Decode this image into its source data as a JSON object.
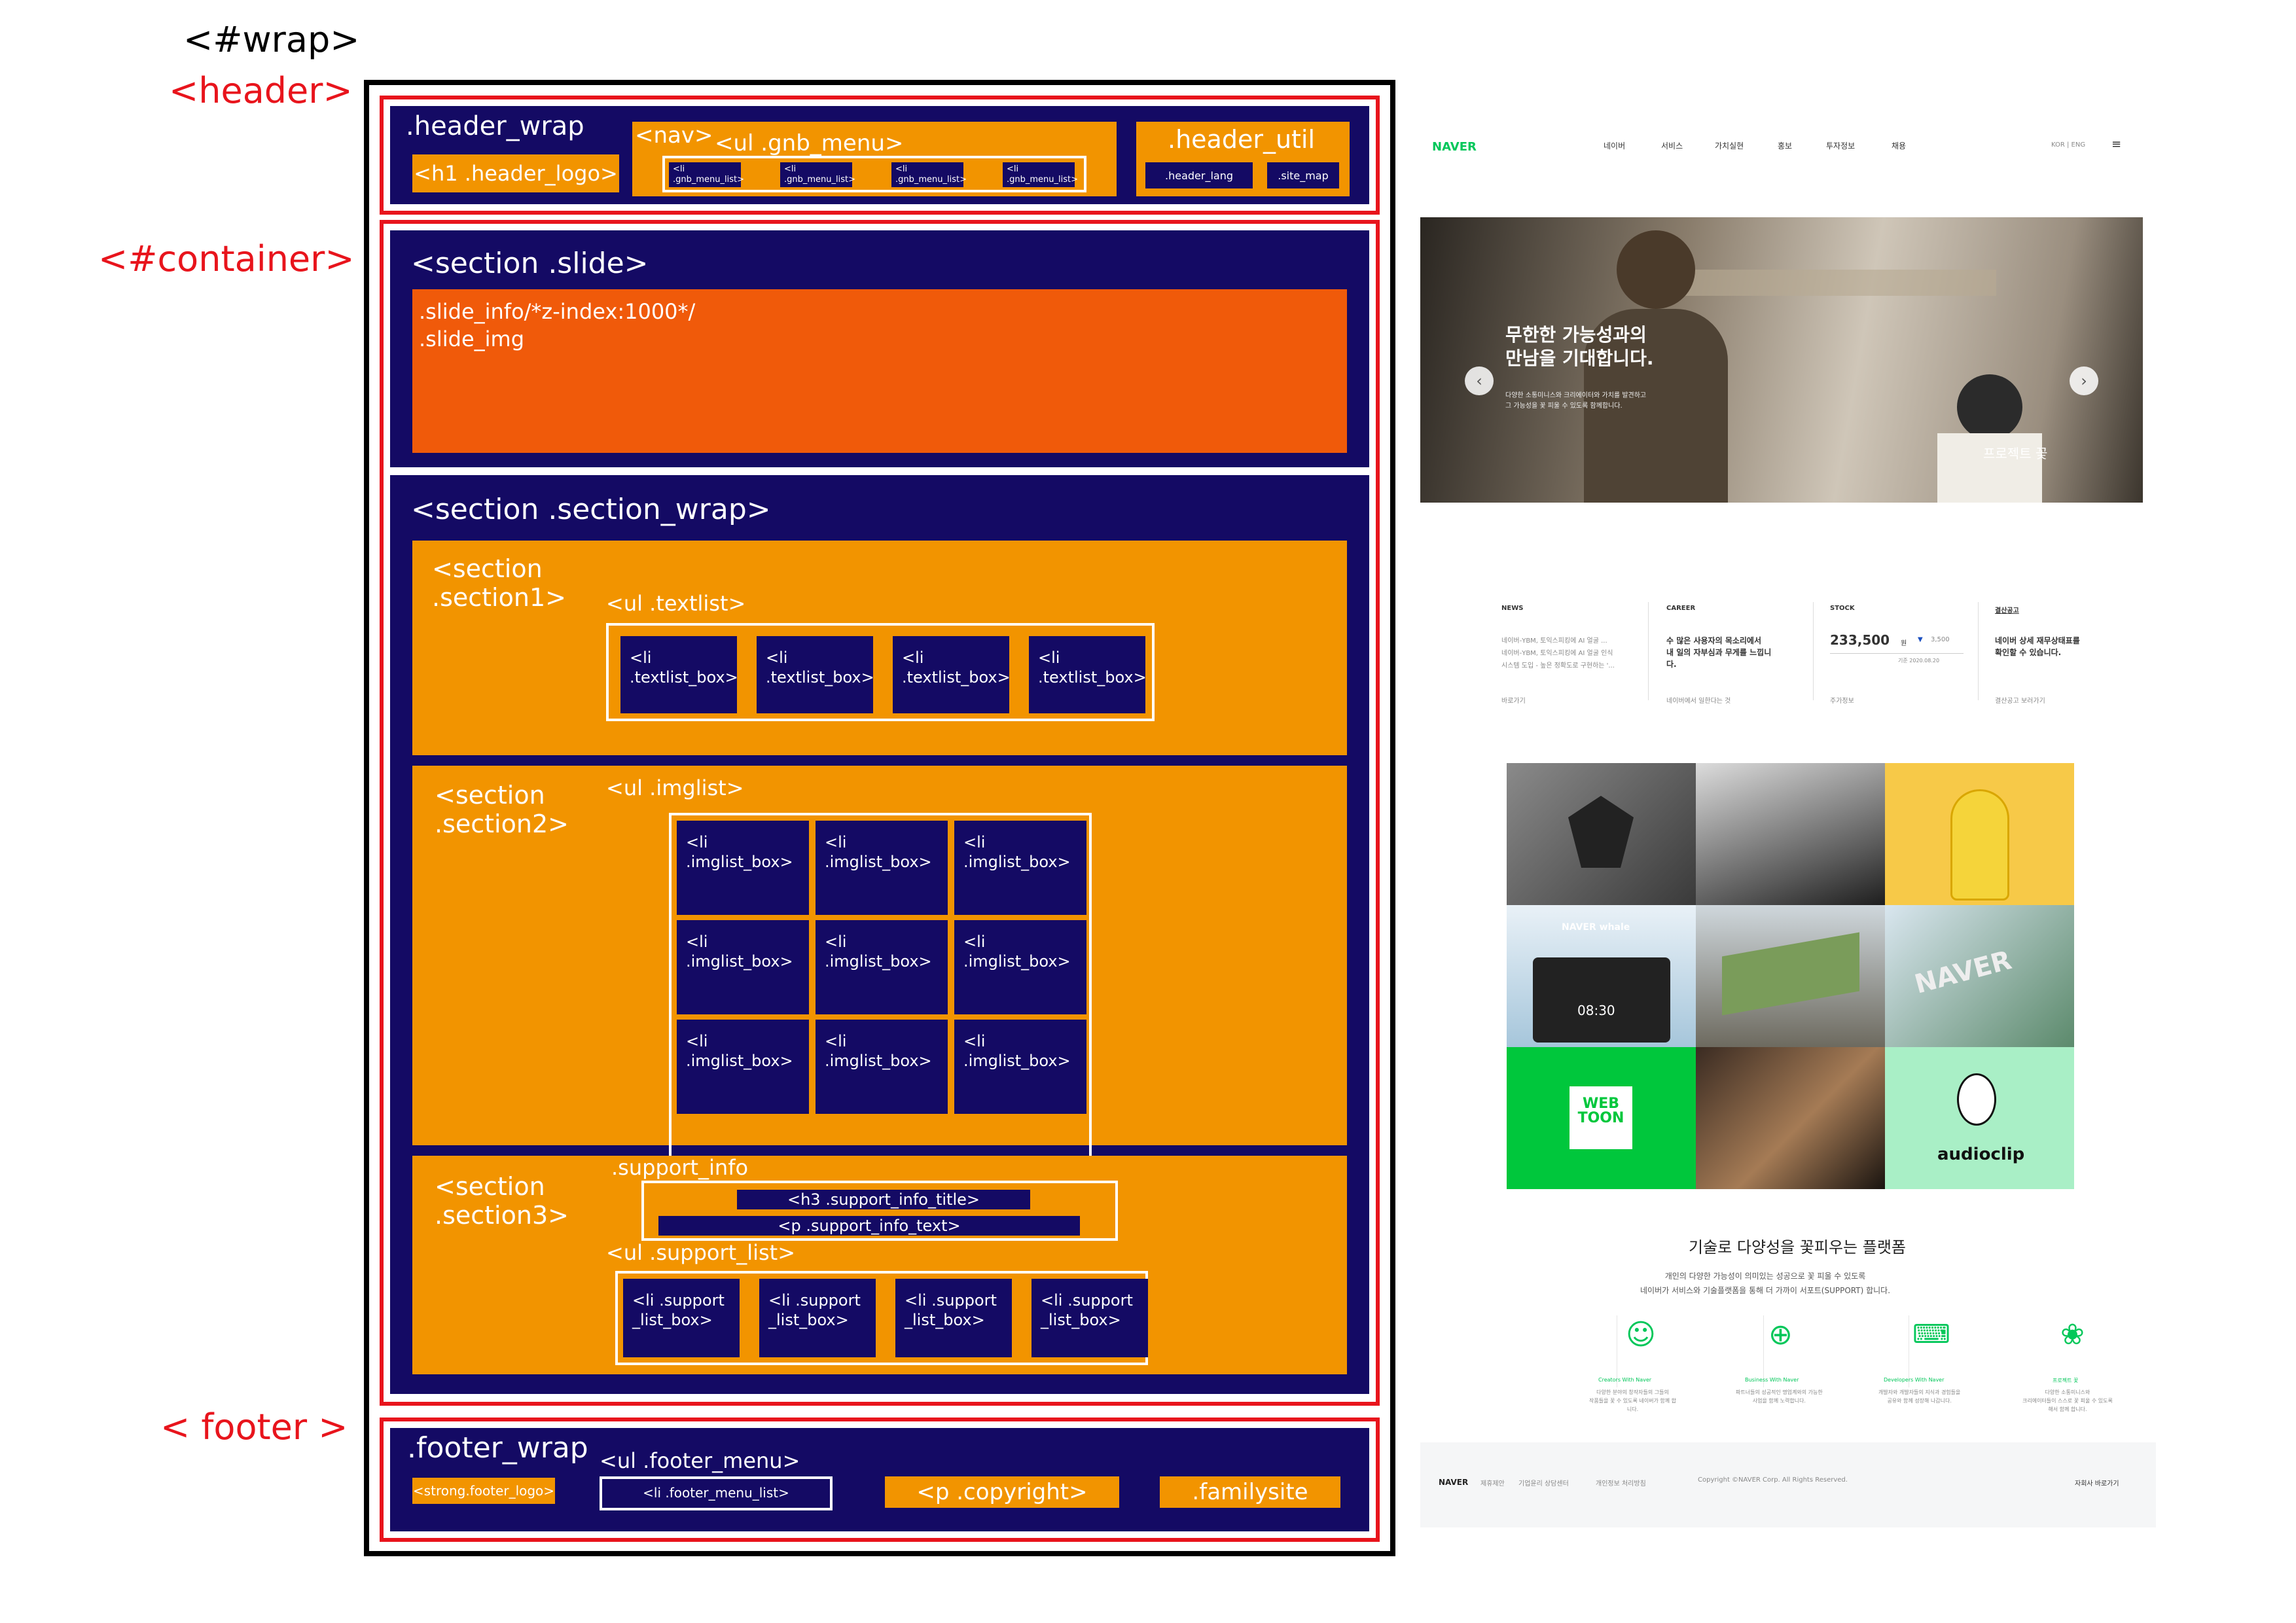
{
  "side_labels": {
    "wrap": "<#wrap>",
    "header": "<header>",
    "container": "<#container>",
    "footer": "< footer >"
  },
  "header": {
    "wrap": ".header_wrap",
    "logo": "<h1 .header_logo>",
    "nav": "<nav>",
    "gnb": "<ul .gnb_menu>",
    "gnb_items": [
      "<li\n.gnb_menu_list>",
      "<li\n.gnb_menu_list>",
      "<li\n.gnb_menu_list>",
      "<li\n.gnb_menu_list>"
    ],
    "util": ".header_util",
    "lang": ".header_lang",
    "sitemap": ".site_map"
  },
  "slide": {
    "title": "<section .slide>",
    "info": ".slide_info/*z-index:1000*/\n.slide_img"
  },
  "section_wrap": {
    "title": "<section .section_wrap>",
    "section1": {
      "label": "<section\n.section1>",
      "list": "<ul .textlist>",
      "items": [
        "<li\n.textlist_box>",
        "<li\n.textlist_box>",
        "<li\n.textlist_box>",
        "<li\n.textlist_box>"
      ]
    },
    "section2": {
      "label": "<section\n.section2>",
      "list": "<ul .imglist>",
      "items": [
        "<li\n.imglist_box>",
        "<li\n.imglist_box>",
        "<li\n.imglist_box>",
        "<li\n.imglist_box>",
        "<li\n.imglist_box>",
        "<li\n.imglist_box>",
        "<li\n.imglist_box>",
        "<li\n.imglist_box>",
        "<li\n.imglist_box>"
      ]
    },
    "section3": {
      "label": "<section\n.section3>",
      "info": ".support_info",
      "title": "<h3 .support_info_title>",
      "text": "<p .support_info_text>",
      "list": "<ul .support_list>",
      "items": [
        "<li .support\n_list_box>",
        "<li .support\n_list_box>",
        "<li .support\n_list_box>",
        "<li .support\n_list_box>"
      ]
    }
  },
  "footer": {
    "wrap": ".footer_wrap",
    "logo": "<strong.footer_logo>",
    "menu": "<ul .footer_menu>",
    "menu_item": "<li .footer_menu_list>",
    "copyright": "<p .copyright>",
    "familysite": ".familysite"
  },
  "mockup": {
    "logo": "NAVER",
    "nav": [
      "네이버",
      "서비스",
      "가치실현",
      "홍보",
      "투자정보",
      "채용"
    ],
    "lang": "KOR  |  ENG",
    "hero_title": "무한한 가능성과의\n만남을 기대합니다.",
    "hero_text": "다양한 소통미니스와 크리에이터와 가치를 발견하고\n그 가능성을 꽃 피울 수 있도록 함께합니다.",
    "hero_caption": "프로젝트 꽃",
    "news": {
      "label": "NEWS",
      "text": "네이버-YBM, 토익스피킹에 AI 얼굴 ...\n네이버-YBM, 토익스피킹에 AI 얼굴 인식\n시스템 도입 - 높은 정확도로 구현하는 '...",
      "link": "바로가기"
    },
    "career": {
      "label": "CAREER",
      "text": "수 많은 사용자의 목소리에서\n내 일의 자부심과 무게를 느낍니\n다.",
      "link": "네이버에서 일한다는 것"
    },
    "stock": {
      "label": "STOCK",
      "value": "233,500",
      "unit": "원",
      "delta": "3,500",
      "date": "기준 2020.08.20",
      "link": "주가정보"
    },
    "notice": {
      "label": "결산공고",
      "text": "네이버 상세 재무상태표를\n확인할 수 있습니다.",
      "link": "결산공고 보러가기"
    },
    "tiles": {
      "whale": "NAVER whale",
      "time": "08:30",
      "naver": "NAVER",
      "webtoon": "WEB\nTOON",
      "audioclip": "audioclip"
    },
    "support_title": "기술로 다양성을 꽃피우는 플랫폼",
    "support_text": "개인의 다양한 가능성이 의미있는 성공으로 꽃 피울 수 있도록\n네이버가 서비스와 기술플랫폼을 통해 더 가까이 서포트(SUPPORT) 합니다.",
    "support_items": [
      {
        "label": "Creators With Naver",
        "desc": "다양한 분야의 창작자들의 그들의\n작품들을 꽃 수 있도록 네이버가 함께 합\n니다."
      },
      {
        "label": "Business With Naver",
        "desc": "파트너들의 성공적인 명업계와의 가능한\n사업을 함께 노력합니다."
      },
      {
        "label": "Developers With Naver",
        "desc": "개발자와 개발자들의 지식과 경험들을\n공유와 함께 성장해 나갑니다."
      },
      {
        "label": "프로젝트 꽃",
        "desc": "다양한 소통미니스와\n크리에이터들이 스스로 꽃 피울 수 있도록\n해서 함께 합니다."
      }
    ],
    "footer_logo": "NAVER",
    "footer_links": [
      "제휴제안",
      "기업윤리 상담센터",
      "개인정보 처리방침"
    ],
    "footer_copy": "Copyright ©NAVER Corp. All Rights Reserved.",
    "footer_family": "자회사 바로가기"
  },
  "colors": {
    "navy": "#140a64",
    "orange": "#f29400",
    "slide_orange": "#f05a0a",
    "red": "#e8141c",
    "naver_green": "#03c75a"
  }
}
